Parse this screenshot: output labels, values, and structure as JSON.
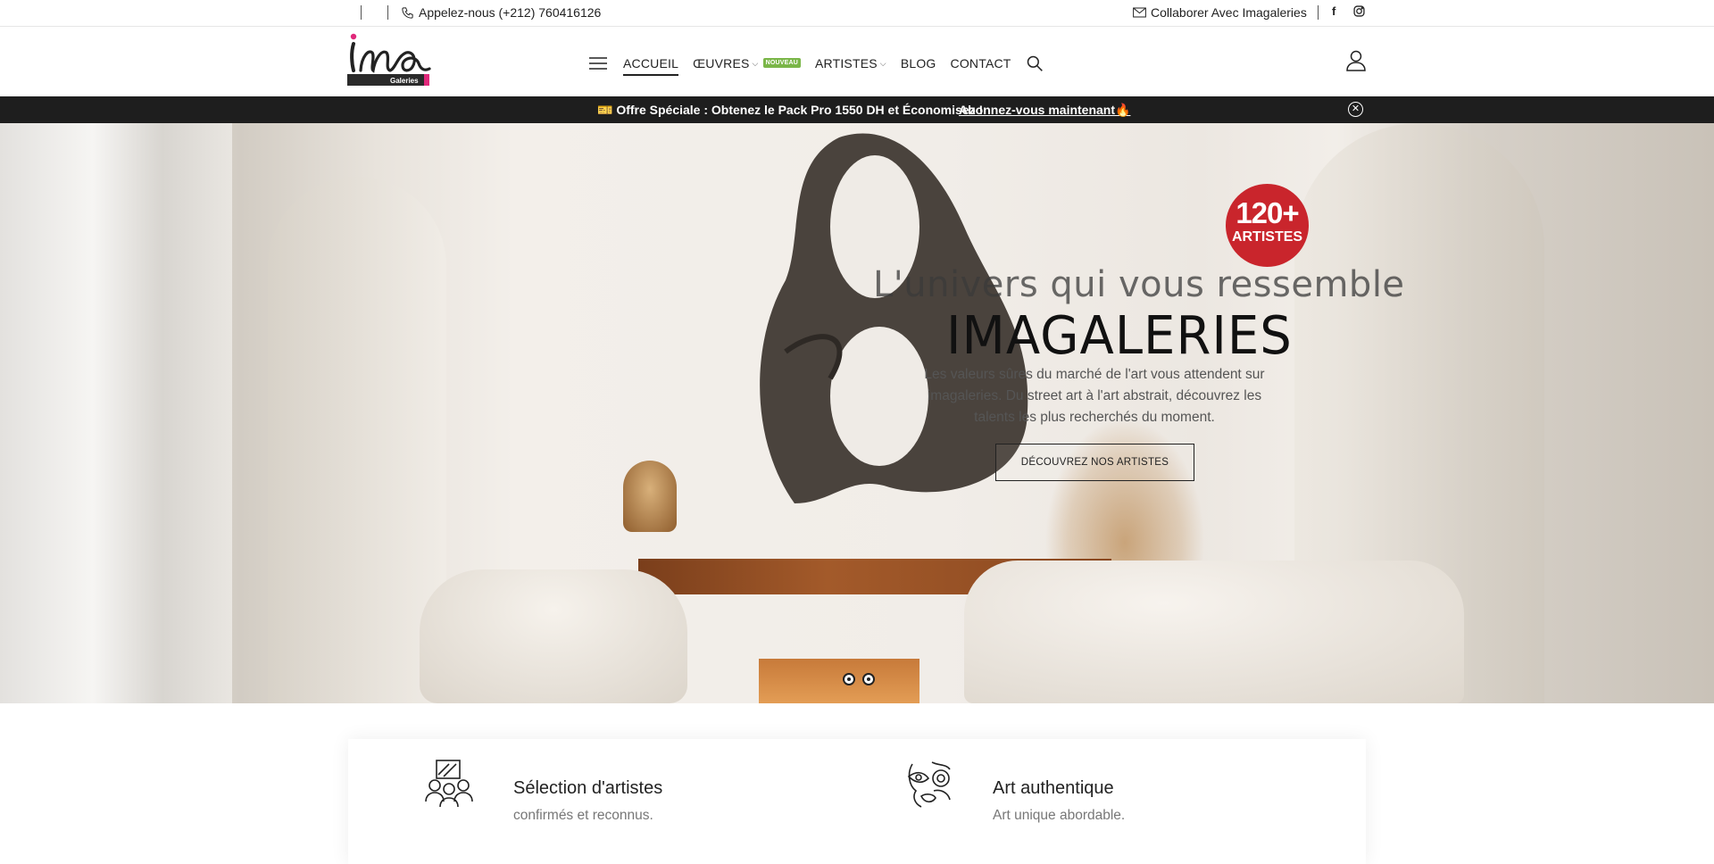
{
  "topbar": {
    "phone": "Appelez-nous (+212) 760416126",
    "collab": "Collaborer Avec Imagaleries",
    "social_facebook": "f",
    "social_instagram": "instagram-icon"
  },
  "header": {
    "logo_text": "ima",
    "logo_sub": "Galeries",
    "nav": [
      {
        "label": "ACCUEIL",
        "active": true
      },
      {
        "label": "ŒUVRES",
        "badge": "NOUVEAU",
        "dropdown": true
      },
      {
        "label": "ARTISTES",
        "dropdown": true
      },
      {
        "label": "BLOG"
      },
      {
        "label": "CONTACT"
      }
    ]
  },
  "promo": {
    "text": "🎫 Offre Spéciale : Obtenez le Pack Pro 1550 DH et Économisez !",
    "link": "Abonnez-vous maintenant🔥"
  },
  "hero": {
    "badge_number": "120+",
    "badge_label": "ARTISTES",
    "tagline": "L'univers qui vous ressemble",
    "brand": "IMAGALERIES",
    "description": "Les valeurs sûres du marché de l'art vous attendent sur imagaleries. Du street art à l'art abstrait, découvrez les talents les plus recherchés du moment.",
    "cta": "DÉCOUVREZ NOS ARTISTES",
    "slides": 2,
    "active_slide": 1
  },
  "features": [
    {
      "title": "Sélection d'artistes",
      "subtitle": "confirmés et reconnus.",
      "icon": "artists-icon"
    },
    {
      "title": "Art authentique",
      "subtitle": "Art unique abordable.",
      "icon": "art-face-icon"
    }
  ],
  "colors": {
    "accent_red": "#c9252c",
    "badge_green": "#7ab648",
    "promo_bg": "#1e1e1e",
    "logo_pink": "#e0287a"
  }
}
